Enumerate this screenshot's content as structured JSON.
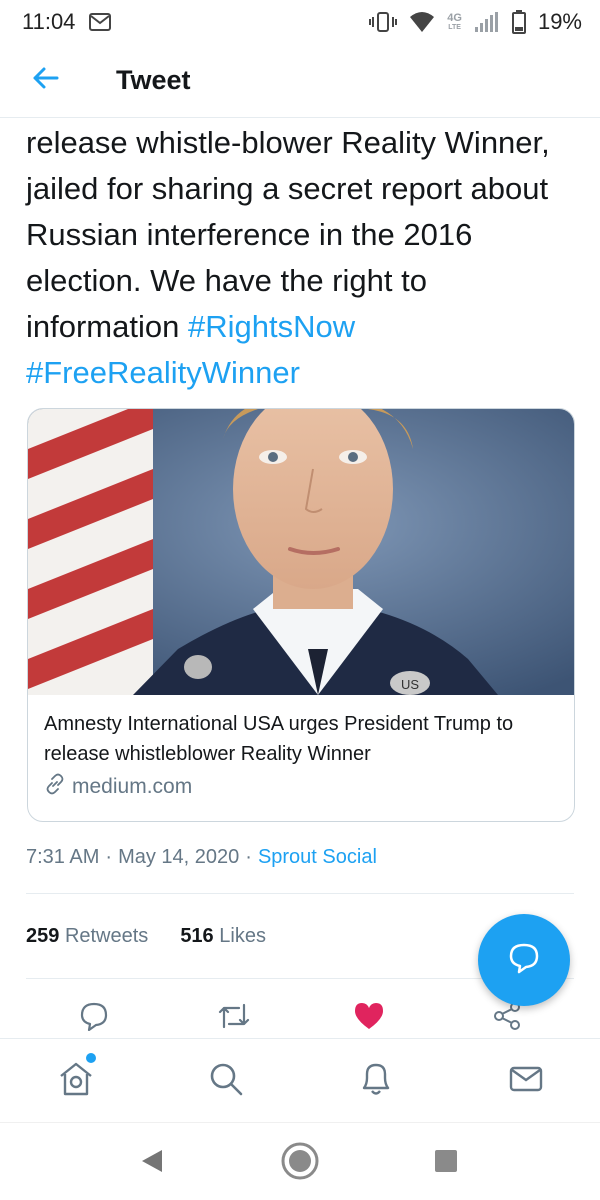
{
  "status_bar": {
    "time": "11:04",
    "network_label": "4G",
    "network_sub_label": "LTE",
    "battery": "19%",
    "icons": [
      "gmail-icon",
      "vibrate-icon",
      "wifi-icon",
      "signal-icon",
      "battery-icon"
    ]
  },
  "header": {
    "title": "Tweet",
    "back_icon": "arrow-left-icon"
  },
  "tweet": {
    "text_segments": [
      {
        "text": "release whistle-blower Reality Winner, jailed for sharing a secret report about Russian interference in the 2016 election. We have the right to information ",
        "type": "text"
      },
      {
        "text": "#RightsNow",
        "type": "hashtag"
      },
      {
        "text": " ",
        "type": "text"
      },
      {
        "text": "#FreeRealityWinner",
        "type": "hashtag"
      }
    ],
    "card": {
      "title": "Amnesty International USA urges President Trump to release whistleblower Reality Winner",
      "domain": "medium.com",
      "image_description": "portrait-photo",
      "insignia_text": "US"
    },
    "meta": {
      "time": "7:31 AM",
      "separator": "·",
      "date": "May 14, 2020",
      "separator2": "·",
      "source": "Sprout Social"
    },
    "stats": {
      "retweets_count": "259",
      "retweets_label": "Retweets",
      "likes_count": "516",
      "likes_label": "Likes"
    },
    "actions": [
      "reply-icon",
      "retweet-icon",
      "like-icon-filled",
      "share-icon"
    ]
  },
  "bottom_nav": [
    "home-icon",
    "search-icon",
    "notifications-icon",
    "messages-icon"
  ],
  "system_nav": [
    "back-triangle-icon",
    "home-circle-icon",
    "recents-square-icon"
  ],
  "colors": {
    "accent": "#1da1f2",
    "like": "#e0245e",
    "text": "#14171a",
    "secondary": "#657786"
  }
}
